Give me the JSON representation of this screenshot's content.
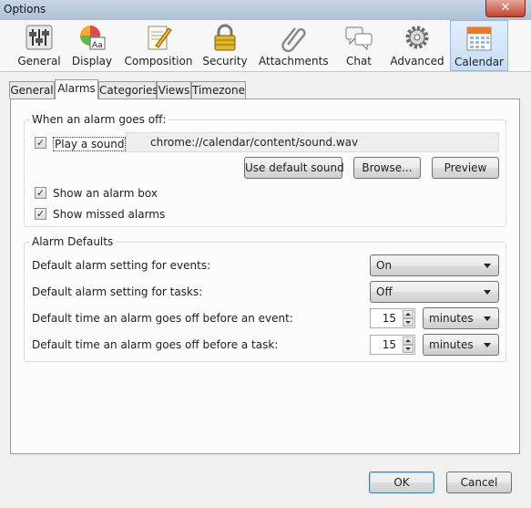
{
  "window": {
    "title": "Options",
    "close_glyph": "✕"
  },
  "toolbar": {
    "items": [
      {
        "label": "General",
        "icon": "sliders-icon"
      },
      {
        "label": "Display",
        "icon": "color-wheel-icon"
      },
      {
        "label": "Composition",
        "icon": "pencil-note-icon"
      },
      {
        "label": "Security",
        "icon": "padlock-icon"
      },
      {
        "label": "Attachments",
        "icon": "paperclip-icon"
      },
      {
        "label": "Chat",
        "icon": "speech-bubbles-icon"
      },
      {
        "label": "Advanced",
        "icon": "gear-icon"
      },
      {
        "label": "Calendar",
        "icon": "calendar-icon"
      }
    ],
    "active": "Calendar"
  },
  "tabs": [
    {
      "label": "General"
    },
    {
      "label": "Alarms"
    },
    {
      "label": "Categories"
    },
    {
      "label": "Views"
    },
    {
      "label": "Timezone"
    }
  ],
  "active_tab": "Alarms",
  "alarm_off": {
    "legend": "When an alarm goes off:",
    "play_sound": {
      "label": "Play a sound",
      "checked": true,
      "check_glyph": "✓"
    },
    "sound_path": "chrome://calendar/content/sound.wav",
    "use_default_label": "Use default sound",
    "browse_label": "Browse...",
    "preview_label": "Preview",
    "show_box": {
      "label": "Show an alarm box",
      "checked": true,
      "check_glyph": "✓"
    },
    "show_missed": {
      "label": "Show missed alarms",
      "checked": true,
      "check_glyph": "✓"
    }
  },
  "alarm_defaults": {
    "legend": "Alarm Defaults",
    "events_label": "Default alarm setting for events:",
    "events_value": "On",
    "tasks_label": "Default alarm setting for tasks:",
    "tasks_value": "Off",
    "event_time_label": "Default time an alarm goes off before an event:",
    "event_time_value": "15",
    "event_time_unit": "minutes",
    "task_time_label": "Default time an alarm goes off before a task:",
    "task_time_value": "15",
    "task_time_unit": "minutes"
  },
  "footer": {
    "ok_label": "OK",
    "cancel_label": "Cancel"
  }
}
